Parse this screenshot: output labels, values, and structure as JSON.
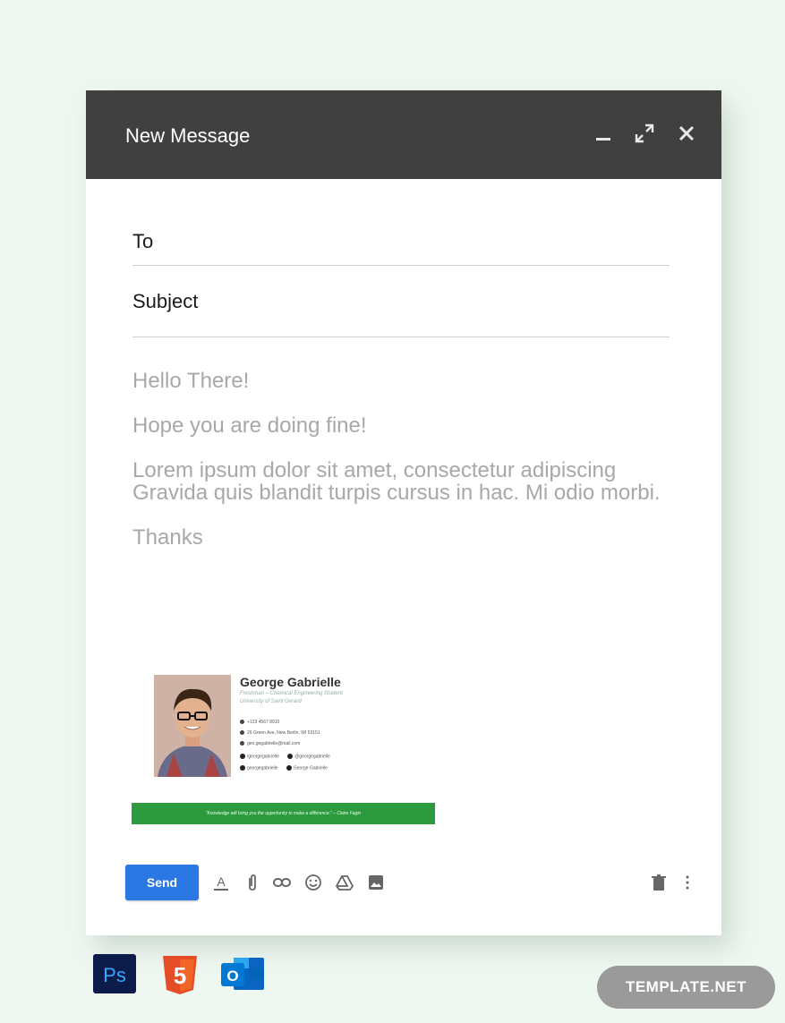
{
  "compose": {
    "title": "New Message",
    "header_icons": [
      "minimize-icon",
      "expand-icon",
      "close-icon"
    ],
    "to_label": "To",
    "to_value": "",
    "subject_label": "Subject",
    "subject_value": ""
  },
  "body": {
    "greeting": "Hello There!",
    "line1": "Hope you are doing fine!",
    "paragraph": "Lorem ipsum dolor sit amet, consectetur adipiscing Gravida quis blandit turpis cursus in hac. Mi odio morbi.",
    "closing": "Thanks"
  },
  "signature": {
    "name": "George Gabrielle",
    "role": "Freshman – Chemical Engineering Student",
    "school": "University of Saint Gerard",
    "phone": "+123 4567 8910",
    "address": "26 Green Ave, New Berlin, WI 53151",
    "email": "geo.gegabrielle@mail.com",
    "social": [
      "/georgegabrielle",
      "@georgegabrielle",
      "georgegabrielle",
      "George Gabrielle"
    ],
    "quote": "“Knowledge will bring you the opportunity to make a difference.” – Claire Fagin"
  },
  "toolbar": {
    "send_label": "Send",
    "tools": [
      "format-text-icon",
      "attach-icon",
      "link-icon",
      "emoji-icon",
      "drive-icon",
      "photo-icon"
    ],
    "right_tools": [
      "trash-icon",
      "more-options-icon"
    ]
  },
  "apps": [
    "photoshop-icon",
    "html5-icon",
    "outlook-icon"
  ],
  "photoshop_label": "Ps",
  "html5_label": "5",
  "outlook_label": "O",
  "brand": "TEMPLATE.NET",
  "colors": {
    "header": "#404040",
    "send": "#2b78e4",
    "quote_bar": "#2e9a3f",
    "page_bg": "#eff7f1"
  }
}
